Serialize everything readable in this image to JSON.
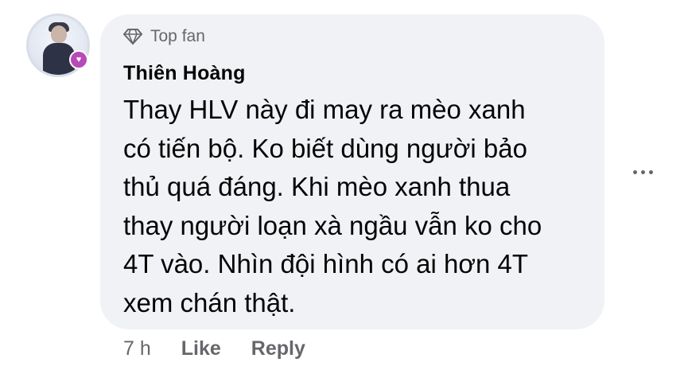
{
  "comment": {
    "badge_icon": "diamond-icon",
    "badge_label": "Top fan",
    "author": "Thiên Hoàng",
    "text": "Thay HLV này đi may ra mèo xanh\ncó tiến bộ. Ko biết dùng người bảo\nthủ quá đáng. Khi mèo xanh thua\nthay người loạn xà ngầu vẫn ko cho\n4T vào. Nhìn đội hình có ai hơn 4T\nxem chán thật.",
    "time": "7 h",
    "like_label": "Like",
    "reply_label": "Reply",
    "more_icon": "more-options-icon"
  },
  "colors": {
    "bubble": "#f0f2f5",
    "text": "#050505",
    "secondary": "#65676b"
  }
}
